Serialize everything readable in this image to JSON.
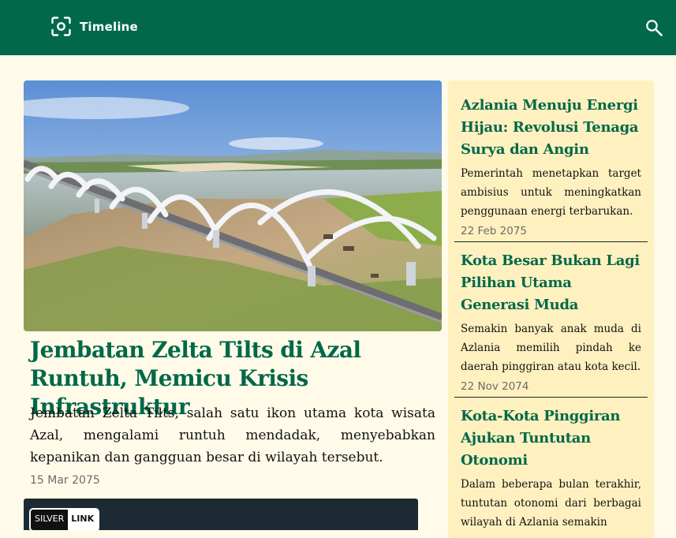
{
  "header": {
    "app_title": "Timeline",
    "logo_icon": "camera-focus-icon",
    "search_icon": "search-icon",
    "background_color": "#02684a"
  },
  "hero": {
    "image_subject": "arched-bridge-over-river",
    "title": "Jembatan Zelta Tilts di Azal Runtuh, Memicu Krisis Infrastruktur",
    "summary": "Jembatan Zelta Tilts, salah satu ikon utama kota wisata Azal, mengalami runtuh mendadak, menyebabkan kepanikan dan gangguan besar di wilayah tersebut.",
    "date": "15 Mar 2075"
  },
  "next_article_thumbnail": {
    "badge_left": "SILVER",
    "badge_right": "LINK"
  },
  "sidebar": {
    "background_color": "#fff1bf",
    "items": [
      {
        "title": "Azlania Menuju Energi Hijau: Revolusi Tenaga Surya dan Angin",
        "summary": "Pemerintah menetapkan target ambisius untuk meningkatkan penggunaan energi terbarukan.",
        "date": "22 Feb 2075"
      },
      {
        "title": "Kota Besar Bukan Lagi Pilihan Utama Generasi Muda",
        "summary": "Semakin banyak anak muda di Azlania memilih pindah ke daerah pinggiran atau kota kecil.",
        "date": "22 Nov 2074"
      },
      {
        "title": "Kota-Kota Pinggiran Ajukan Tuntutan Otonomi",
        "summary": "Dalam beberapa bulan terakhir, tuntutan otonomi dari berbagai wilayah di Azlania semakin",
        "date": ""
      }
    ]
  },
  "colors": {
    "accent": "#02684a",
    "page_background": "#fffbe8",
    "date_text": "#6b6b6b"
  }
}
